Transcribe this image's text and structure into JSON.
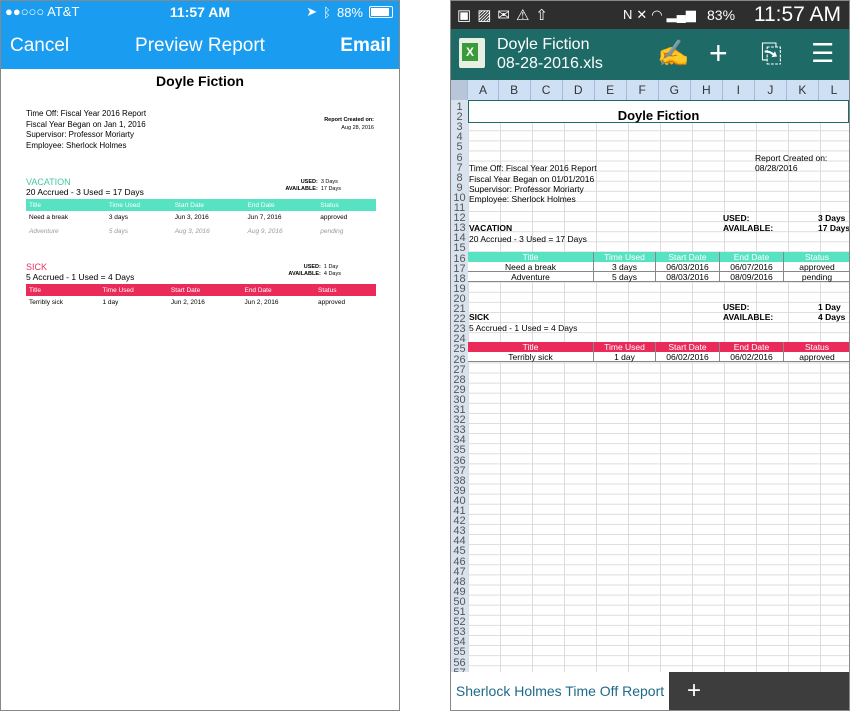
{
  "ios": {
    "status": {
      "carrier": "●●○○○ AT&T",
      "time": "11:57 AM",
      "battery": "88%"
    },
    "nav": {
      "cancel": "Cancel",
      "title": "Preview Report",
      "email": "Email"
    },
    "report": {
      "title": "Doyle Fiction",
      "lines": [
        "Time Off: Fiscal Year 2016 Report",
        "Fiscal Year Began on Jan 1, 2016",
        "Supervisor: Professor Moriarty",
        "Employee: Sherlock Holmes"
      ],
      "created_label": "Report Created on:",
      "created_date": "Aug 28, 2016",
      "columns": [
        "Title",
        "Time Used",
        "Start Date",
        "End Date",
        "Status"
      ],
      "vacation": {
        "name": "VACATION",
        "summary": "20 Accrued - 3 Used = 17 Days",
        "used_label": "USED:",
        "used": "3 Days",
        "available_label": "AVAILABLE:",
        "available": "17 Days",
        "rows": [
          [
            "Need a break",
            "3 days",
            "Jun 3, 2016",
            "Jun 7, 2016",
            "approved"
          ],
          [
            "Adventure",
            "5 days",
            "Aug 3, 2016",
            "Aug 9, 2016",
            "pending"
          ]
        ]
      },
      "sick": {
        "name": "SICK",
        "summary": "5 Accrued - 1 Used = 4 Days",
        "used_label": "USED:",
        "used": "1 Day",
        "available_label": "AVAILABLE:",
        "available": "4 Days",
        "rows": [
          [
            "Terribly sick",
            "1 day",
            "Jun 2, 2016",
            "Jun 2, 2016",
            "approved"
          ]
        ]
      }
    }
  },
  "android": {
    "status": {
      "battery": "83%",
      "time": "11:57 AM"
    },
    "toolbar": {
      "doc_line1": "Doyle Fiction",
      "doc_line2": "08-28-2016.xls"
    },
    "columns": [
      "A",
      "B",
      "C",
      "D",
      "E",
      "F",
      "G",
      "H",
      "I",
      "J",
      "K",
      "L"
    ],
    "sheet": {
      "title": "Doyle Fiction",
      "created_label": "Report Created on:",
      "created_date": "08/28/2016",
      "lines": [
        "Time Off: Fiscal Year 2016 Report",
        "Fiscal Year Began on 01/01/2016",
        "Supervisor: Professor Moriarty",
        "Employee: Sherlock Holmes"
      ],
      "headers": [
        "Title",
        "Time Used",
        "Start Date",
        "End Date",
        "Status"
      ],
      "vacation": {
        "used_label": "USED:",
        "used": "3 Days",
        "available_label": "AVAILABLE:",
        "available": "17 Days",
        "name": "VACATION",
        "summary": "20 Accrued  - 3 Used  = 17 Days",
        "rows": [
          [
            "Need a break",
            "3 days",
            "06/03/2016",
            "06/07/2016",
            "approved"
          ],
          [
            "Adventure",
            "5 days",
            "08/03/2016",
            "08/09/2016",
            "pending"
          ]
        ]
      },
      "sick": {
        "used_label": "USED:",
        "used": "1 Day",
        "available_label": "AVAILABLE:",
        "available": "4 Days",
        "name": "SICK",
        "summary": "5 Accrued  - 1 Used  = 4 Days",
        "rows": [
          [
            "Terribly sick",
            "1 day",
            "06/02/2016",
            "06/02/2016",
            "approved"
          ]
        ]
      }
    },
    "tab": {
      "label": "Sherlock Holmes Time Off Report",
      "add": "+"
    }
  }
}
